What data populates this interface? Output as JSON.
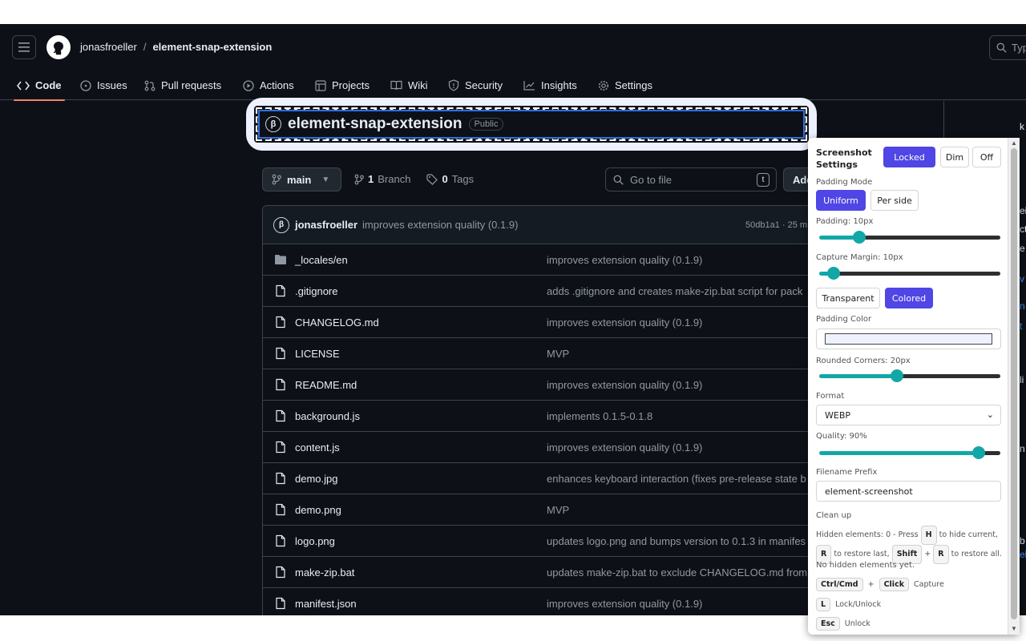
{
  "header": {
    "owner": "jonasfroeller",
    "separator": "/",
    "repo": "element-snap-extension",
    "search_placeholder": "Typ"
  },
  "nav": [
    {
      "label": "Code",
      "icon": "code-icon",
      "active": true
    },
    {
      "label": "Issues",
      "icon": "issue-icon"
    },
    {
      "label": "Pull requests",
      "icon": "pull-request-icon"
    },
    {
      "label": "Actions",
      "icon": "play-icon"
    },
    {
      "label": "Projects",
      "icon": "table-icon"
    },
    {
      "label": "Wiki",
      "icon": "book-icon"
    },
    {
      "label": "Security",
      "icon": "shield-icon"
    },
    {
      "label": "Insights",
      "icon": "graph-icon"
    },
    {
      "label": "Settings",
      "icon": "gear-icon"
    }
  ],
  "repo_title": {
    "avatar_letter": "β",
    "name": "element-snap-extension",
    "visibility": "Public"
  },
  "branch": {
    "name": "main",
    "branches_count": "1",
    "branches_label": "Branch",
    "tags_count": "0",
    "tags_label": "Tags",
    "go_to_file": "Go to file",
    "go_to_file_key": "t",
    "add_file": "Add"
  },
  "commit": {
    "avatar_letter": "β",
    "author": "jonasfroeller",
    "message": "improves extension quality (0.1.9)",
    "sha": "50db1a1 · 25 m"
  },
  "files": [
    {
      "name": "_locales/en",
      "type": "folder",
      "message": "improves extension quality (0.1.9)"
    },
    {
      "name": ".gitignore",
      "type": "file",
      "message": "adds .gitignore and creates make-zip.bat script for pack"
    },
    {
      "name": "CHANGELOG.md",
      "type": "file",
      "message": "improves extension quality (0.1.9)"
    },
    {
      "name": "LICENSE",
      "type": "file",
      "message": "MVP"
    },
    {
      "name": "README.md",
      "type": "file",
      "message": "improves extension quality (0.1.9)"
    },
    {
      "name": "background.js",
      "type": "file",
      "message": "implements 0.1.5-0.1.8"
    },
    {
      "name": "content.js",
      "type": "file",
      "message": "improves extension quality (0.1.9)"
    },
    {
      "name": "demo.jpg",
      "type": "file",
      "message": "enhances keyboard interaction (fixes pre-release state b"
    },
    {
      "name": "demo.png",
      "type": "file",
      "message": "MVP"
    },
    {
      "name": "logo.png",
      "type": "file",
      "message": "updates logo.png and bumps version to 0.1.3 in manifes"
    },
    {
      "name": "make-zip.bat",
      "type": "file",
      "message": "updates make-zip.bat to exclude CHANGELOG.md from"
    },
    {
      "name": "manifest.json",
      "type": "file",
      "message": "improves extension quality (0.1.9)"
    }
  ],
  "side_fragments": [
    "k",
    "ei",
    "ct",
    "e",
    "v",
    "n",
    "t",
    "li",
    "n",
    "b",
    "el"
  ],
  "panel": {
    "title": "Screenshot Settings",
    "lock_modes": [
      "Locked",
      "Dim",
      "Off"
    ],
    "lock_selected": "Locked",
    "padding_mode_label": "Padding Mode",
    "padding_modes": [
      "Uniform",
      "Per side"
    ],
    "padding_mode_selected": "Uniform",
    "padding_label": "Padding: 10px",
    "padding_level": 0.22,
    "capture_margin_label": "Capture Margin: 10px",
    "capture_margin_level": 0.08,
    "background_modes": [
      "Transparent",
      "Colored"
    ],
    "background_selected": "Colored",
    "padding_color_label": "Padding Color",
    "padding_color": "#eef2ff",
    "rounded_label": "Rounded Corners: 20px",
    "rounded_level": 0.43,
    "format_label": "Format",
    "format_value": "WEBP",
    "quality_label": "Quality: 90%",
    "quality_level": 0.88,
    "filename_label": "Filename Prefix",
    "filename_value": "element-screenshot",
    "cleanup_label": "Clean up",
    "hidden_text_1": "Hidden elements: 0 - Press",
    "hidden_key_1": "H",
    "hidden_text_2": "to hide current,",
    "hidden_key_2": "R",
    "hidden_text_3": "to restore last,",
    "hidden_key_3": "Shift",
    "hidden_plus": "+",
    "hidden_key_4": "R",
    "hidden_text_4": "to restore all.",
    "no_hidden": "No hidden elements yet.",
    "shortcut_capture_key1": "Ctrl/Cmd",
    "shortcut_plus": "+",
    "shortcut_capture_key2": "Click",
    "shortcut_capture_label": "Capture",
    "shortcut_lock_key": "L",
    "shortcut_lock_label": "Lock/Unlock",
    "shortcut_esc_key": "Esc",
    "shortcut_esc_label": "Unlock",
    "accent_color": "#4f46e5",
    "slider_color": "#12a7a7"
  }
}
